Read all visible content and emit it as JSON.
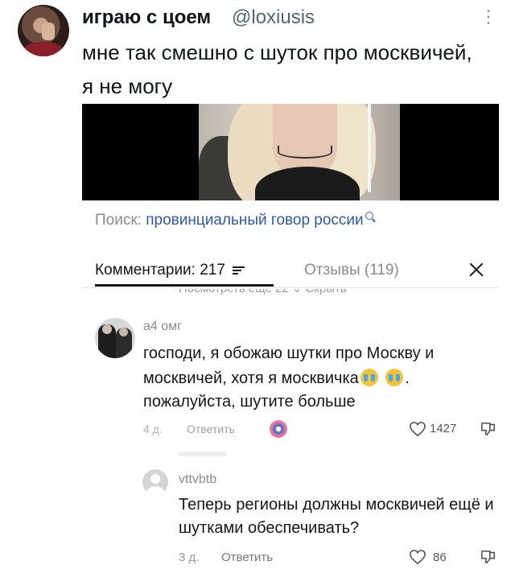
{
  "tweet": {
    "display_name": "играю с цоем",
    "handle": "@loxiusis",
    "more_icon": "more-vertical-icon",
    "text": "мне так смешно с шуток про москвичей, я не могу"
  },
  "comments_sheet": {
    "search_label": "Поиск:",
    "search_query": "провинциальный говор россии",
    "tab_comments": "Комментарии: 217",
    "tab_reviews": "Отзывы (119)",
    "cut_text": "Посмотреть еще 22 ⌄      Скрыть",
    "comments": [
      {
        "username": "а4 омг",
        "text_before": "господи, я обожаю шутки про Москву и москвичей, хотя я москвичка",
        "text_after": ". пожалуйста, шутите больше",
        "emoji": "loudly-crying-face",
        "time": "4 д.",
        "reply_label": "Ответить",
        "likes": "1427"
      },
      {
        "username": "vttvbtb",
        "text": "Теперь регионы должны москвичей ещё и шутками обеспечивать?",
        "time": "3 д.",
        "reply_label": "Ответить",
        "likes": "86"
      }
    ]
  },
  "colors": {
    "link_blue": "#2f5aa8",
    "muted_gray": "#8a8a8a",
    "text_dark": "#161616"
  }
}
